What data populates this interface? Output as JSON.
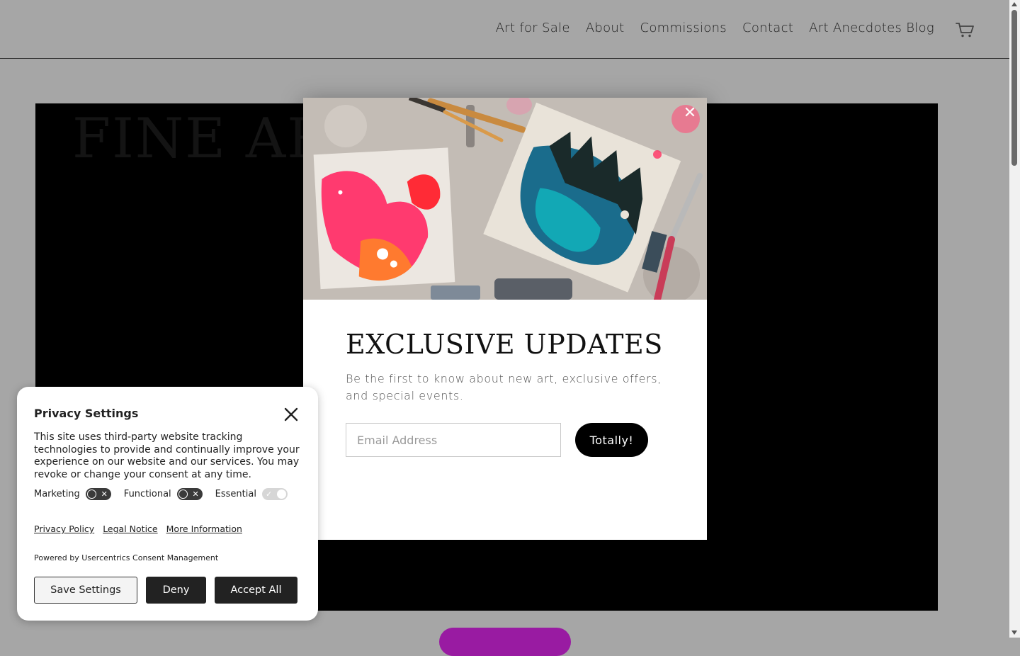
{
  "nav": {
    "items": [
      "Art for Sale",
      "About",
      "Commissions",
      "Contact",
      "Art Anecdotes Blog"
    ],
    "cart_icon": "shopping-cart-icon"
  },
  "hero": {
    "title": "FINE ART"
  },
  "popup": {
    "close_icon": "close-icon",
    "image": "painting-studio-photo",
    "heading": "EXCLUSIVE UPDATES",
    "subtext": "Be the first to know about new art, exclusive offers, and special events.",
    "email_placeholder": "Email Address",
    "submit_label": "Totally!"
  },
  "consent": {
    "title": "Privacy Settings",
    "body": "This site uses third-party website tracking technologies to provide and continually improve your experience on our website and our services. You may revoke or change your consent at any time.",
    "toggles": [
      {
        "label": "Marketing",
        "state": "off"
      },
      {
        "label": "Functional",
        "state": "off"
      },
      {
        "label": "Essential",
        "state": "on-disabled"
      }
    ],
    "links": [
      "Privacy Policy",
      "Legal Notice",
      "More Information"
    ],
    "powered_by": "Powered by Usercentrics Consent Management",
    "buttons": {
      "save": "Save Settings",
      "deny": "Deny",
      "accept": "Accept All"
    }
  },
  "colors": {
    "overlay_bg": "#a6a6a6",
    "accent_purple": "#991ba2",
    "button_dark": "#222222"
  }
}
